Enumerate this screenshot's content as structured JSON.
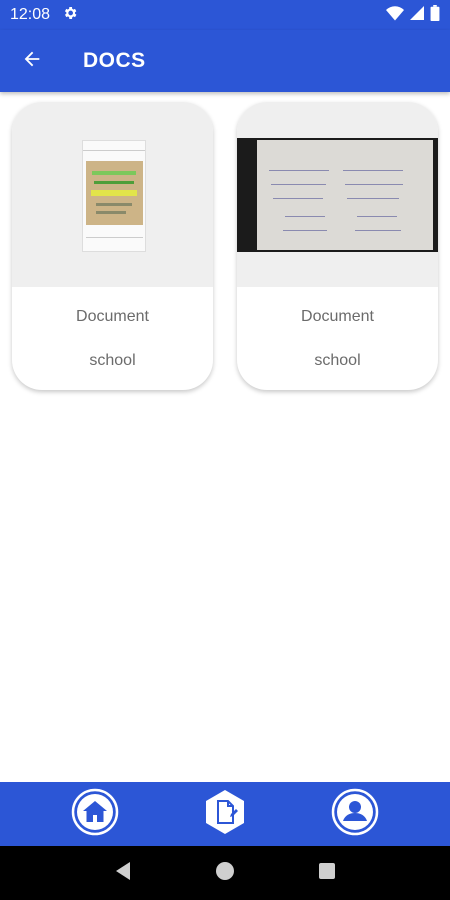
{
  "status_bar": {
    "time": "12:08"
  },
  "app_bar": {
    "title": "DOCS"
  },
  "documents": [
    {
      "name": "Document",
      "category": "school"
    },
    {
      "name": "Document",
      "category": "school"
    }
  ],
  "colors": {
    "primary": "#2c56d6",
    "card_thumb_bg": "#efefef",
    "text_muted": "#6b6b6b"
  },
  "icons": {
    "status": [
      "gear-icon",
      "wifi-icon",
      "signal-icon",
      "battery-icon"
    ],
    "app_bar": "back-arrow-icon",
    "bottom_nav": [
      "home-icon",
      "document-edit-icon",
      "profile-icon"
    ],
    "system_nav": [
      "back-triangle-icon",
      "home-circle-icon",
      "recents-square-icon"
    ]
  }
}
